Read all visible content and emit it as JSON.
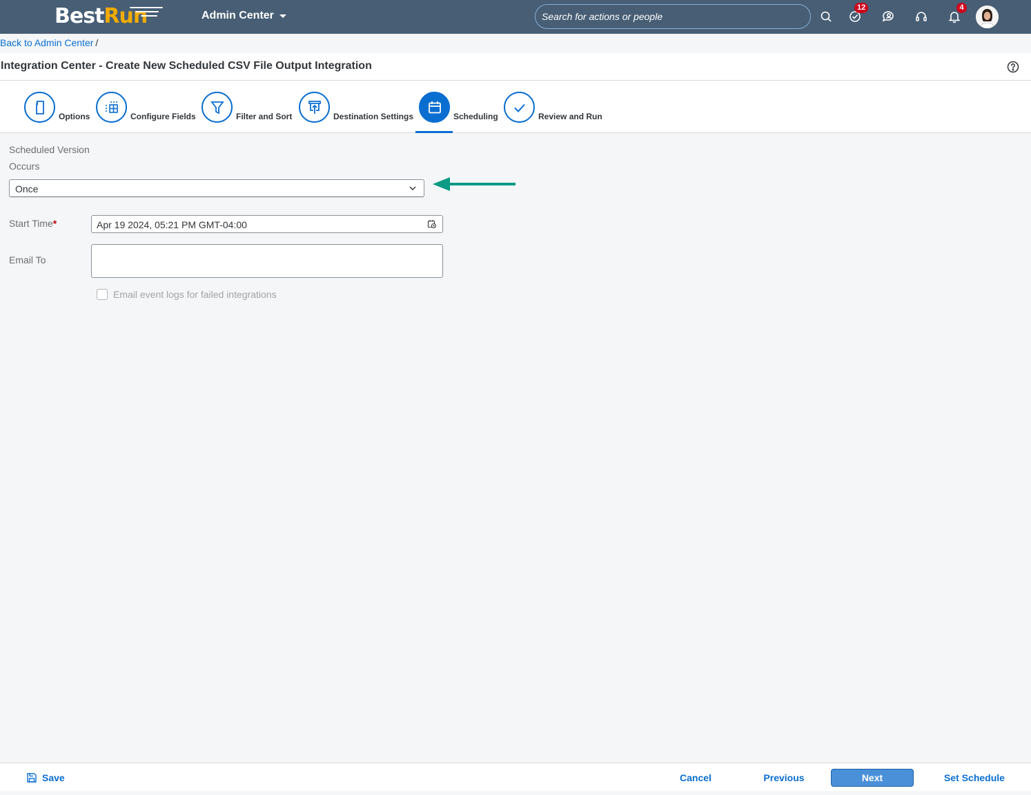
{
  "shell": {
    "logo_part1": "Best",
    "logo_part2": "Run",
    "app_title": "Admin Center",
    "search_placeholder": "Search for actions or people",
    "todo_badge": "12",
    "notification_badge": "4"
  },
  "breadcrumb": {
    "back_link": "Back to Admin Center",
    "separator": "/"
  },
  "header": {
    "title": "Integration Center - Create New Scheduled CSV File Output Integration"
  },
  "steps": [
    {
      "label": "Options",
      "icon": "document-icon"
    },
    {
      "label": "Configure Fields",
      "icon": "table-grid-icon"
    },
    {
      "label": "Filter and Sort",
      "icon": "filter-icon"
    },
    {
      "label": "Destination Settings",
      "icon": "upload-icon"
    },
    {
      "label": "Scheduling",
      "icon": "calendar-icon",
      "active": true
    },
    {
      "label": "Review and Run",
      "icon": "checkmark-icon"
    }
  ],
  "form": {
    "section_label": "Scheduled Version",
    "occurs_label": "Occurs",
    "occurs_value": "Once",
    "start_time_label": "Start Time",
    "required_marker": "*",
    "start_time_value": "Apr 19 2024, 05:21 PM GMT-04:00",
    "email_to_label": "Email To",
    "email_to_value": "",
    "checkbox_label": "Email event logs for failed integrations",
    "checkbox_checked": false
  },
  "footer": {
    "save": "Save",
    "cancel": "Cancel",
    "previous": "Previous",
    "next": "Next",
    "set_schedule": "Set Schedule"
  },
  "colors": {
    "shell": "#475e75",
    "brand_accent": "#f0ab00",
    "primary": "#0a6ed1",
    "annotation_arrow": "#0a9a86",
    "badge": "#d0021b"
  }
}
